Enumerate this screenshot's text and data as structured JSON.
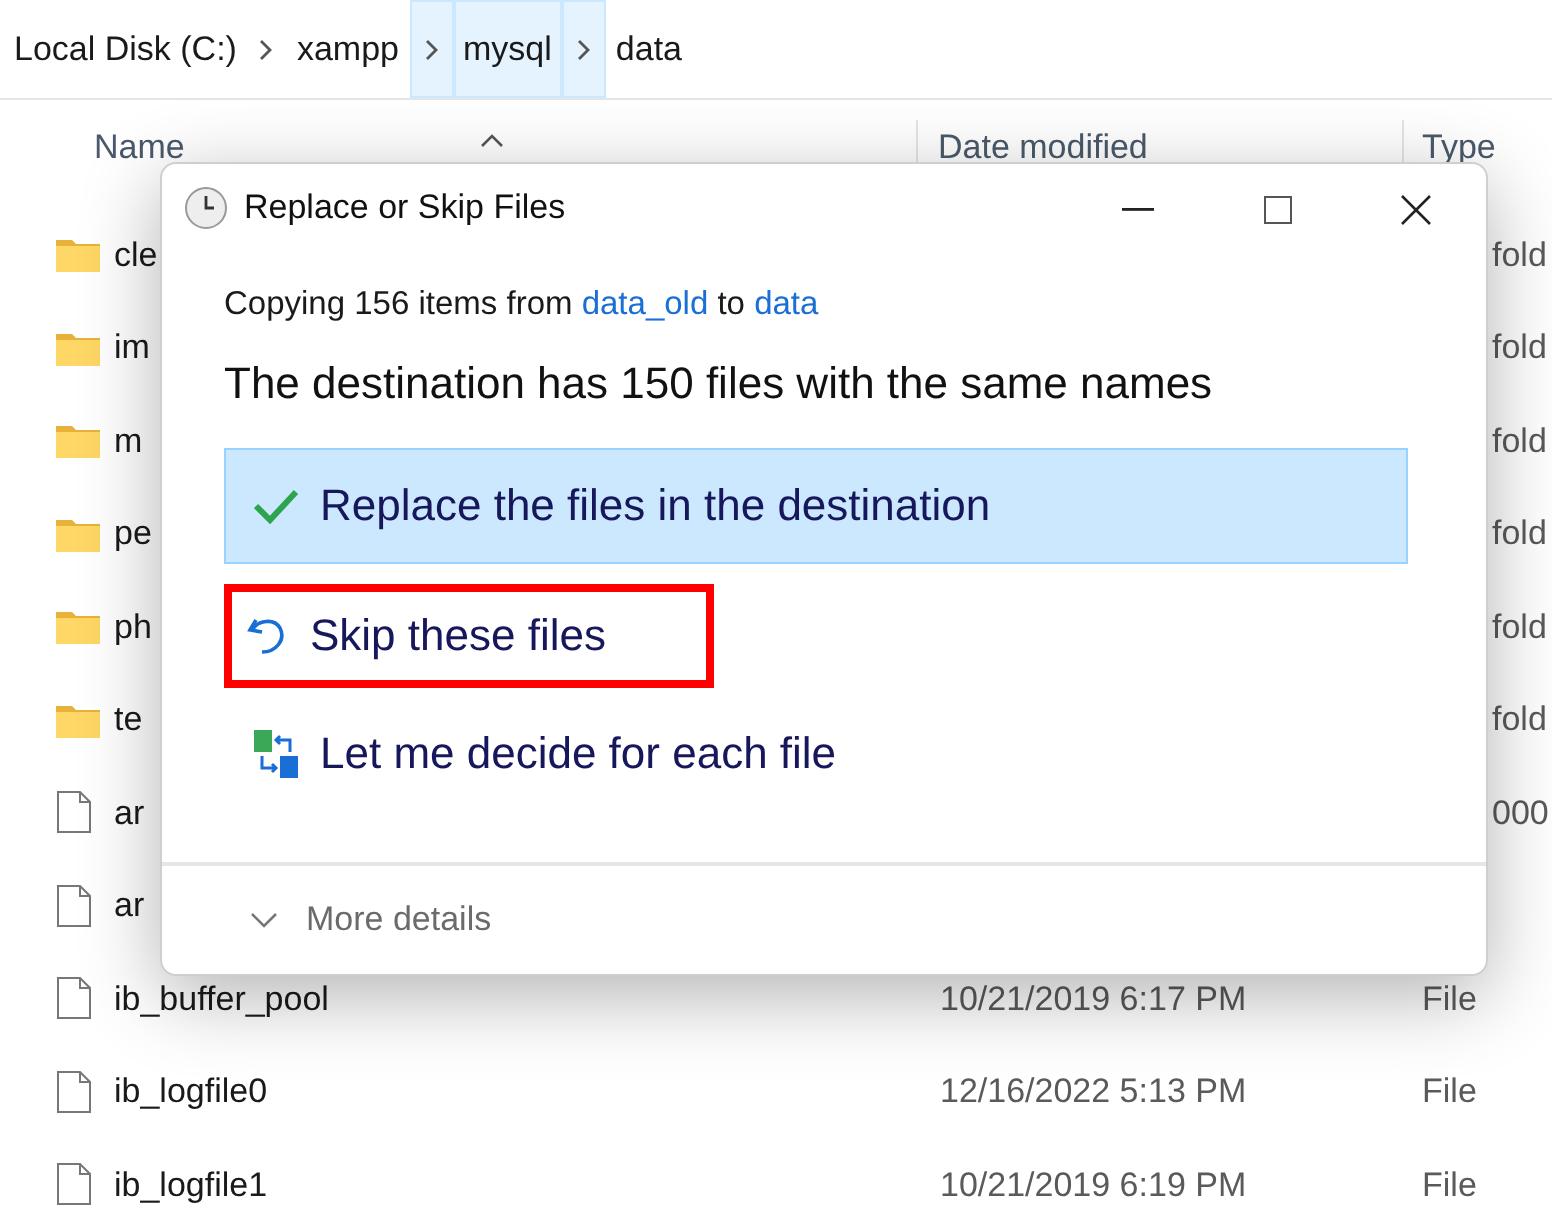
{
  "breadcrumb": [
    {
      "label": "Local Disk (C:)",
      "selected": false
    },
    {
      "label": "xampp",
      "selected": false
    },
    {
      "label": "mysql",
      "selected": true
    },
    {
      "label": "data",
      "selected": false
    }
  ],
  "columns": [
    "Name",
    "Date modified",
    "Type"
  ],
  "rows": [
    {
      "kind": "folder",
      "name": "cle",
      "date": "",
      "type": "fold"
    },
    {
      "kind": "folder",
      "name": "im",
      "date": "",
      "type": "fold"
    },
    {
      "kind": "folder",
      "name": "m",
      "date": "",
      "type": "fold"
    },
    {
      "kind": "folder",
      "name": "pe",
      "date": "",
      "type": "fold"
    },
    {
      "kind": "folder",
      "name": "ph",
      "date": "",
      "type": "fold"
    },
    {
      "kind": "folder",
      "name": "te",
      "date": "",
      "type": "fold"
    },
    {
      "kind": "file",
      "name": "ar",
      "date": "",
      "type": "000"
    },
    {
      "kind": "file",
      "name": "ar",
      "date": "",
      "type": ""
    },
    {
      "kind": "file",
      "name": "ib_buffer_pool",
      "date": "10/21/2019 6:17 PM",
      "type": "File"
    },
    {
      "kind": "file",
      "name": "ib_logfile0",
      "date": "12/16/2022 5:13 PM",
      "type": "File"
    },
    {
      "kind": "file",
      "name": "ib_logfile1",
      "date": "10/21/2019 6:19 PM",
      "type": "File"
    }
  ],
  "dialog": {
    "title": "Replace or Skip Files",
    "copying": {
      "prefix": "Copying 156 items from",
      "source": "data_old",
      "middle": "to",
      "destination": "data"
    },
    "heading": "The destination has 150 files with the same names",
    "options": [
      {
        "kind": "replace",
        "label": "Replace the files in the destination",
        "selected": true,
        "outlined": false
      },
      {
        "kind": "skip",
        "label": "Skip these files",
        "selected": false,
        "outlined": true
      },
      {
        "kind": "decide",
        "label": "Let me decide for each file",
        "selected": false,
        "outlined": false
      }
    ],
    "more_details": "More details"
  }
}
